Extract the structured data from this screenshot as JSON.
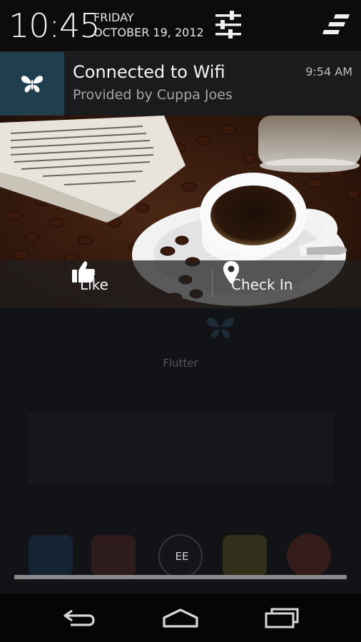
{
  "status": {
    "time": "10:45",
    "day": "FRIDAY",
    "date": "OCTOBER 19, 2012"
  },
  "notification": {
    "title": "Connected to Wifi",
    "subtitle": "Provided by Cuppa Joes",
    "time": "9:54 AM",
    "icon": "butterfly-icon",
    "icon_bg": "#1f3f4f",
    "picture": "coffee-cup-on-newspaper-with-beans"
  },
  "actions": [
    {
      "label": "Like",
      "icon": "thumbs-up-icon"
    },
    {
      "label": "Check In",
      "icon": "location-pin-icon"
    }
  ],
  "background_app": {
    "label": "Flutter",
    "dock_center_label": "EE"
  },
  "navbar": {
    "buttons": [
      "back",
      "home",
      "recent-apps"
    ]
  }
}
